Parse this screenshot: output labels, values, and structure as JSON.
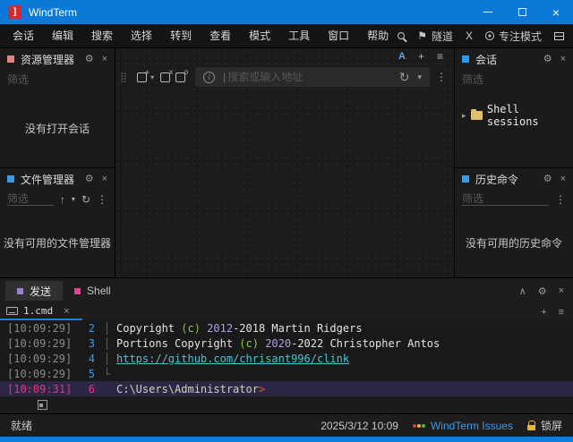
{
  "titlebar": {
    "app_title": "WindTerm"
  },
  "menubar": {
    "items": [
      "会话",
      "编辑",
      "搜索",
      "选择",
      "转到",
      "查看",
      "模式",
      "工具",
      "窗口",
      "帮助"
    ],
    "tunnel_label": "隧道",
    "x_server_label": "X",
    "focus_mode_label": "专注模式"
  },
  "glyphs": {
    "flag": "⚑",
    "gear": "⚙",
    "close": "×",
    "more": "⋮",
    "collapse": "∧",
    "plus": "+",
    "menu": "≡",
    "caret": "▾",
    "up": "↑",
    "refresh": "↻",
    "grip": "⣿",
    "tree_expand": "▸",
    "font_size": "A",
    "cursor": "|",
    "info": "i"
  },
  "panels": {
    "explorer": {
      "title": "资源管理器",
      "filter_placeholder": "筛选",
      "empty_text": "没有打开会话",
      "accent": "#e08585"
    },
    "file_manager": {
      "title": "文件管理器",
      "filter_placeholder": "筛选",
      "empty_text": "没有可用的文件管理器",
      "accent": "#3d9ae8"
    },
    "sessions": {
      "title": "会话",
      "filter_placeholder": "筛选",
      "tree_item_label": "Shell sessions",
      "accent": "#2b9af3"
    },
    "history": {
      "title": "历史命令",
      "filter_placeholder": "筛选",
      "empty_text": "没有可用的历史命令",
      "accent": "#3d9ae8"
    }
  },
  "address_bar": {
    "placeholder": "搜索或输入地址"
  },
  "bottom": {
    "tabs": [
      {
        "label": "发送",
        "color": "#9b7fd4",
        "active": true
      },
      {
        "label": "Shell",
        "color": "#e83e9c",
        "active": false
      }
    ],
    "doc_tab": {
      "label": "1.cmd"
    },
    "terminal": {
      "lines": [
        {
          "ts": "[10:09:29]",
          "num": "2",
          "guide": "│",
          "active": false,
          "segments": [
            {
              "text": "Copyright ",
              "cls": "c-white"
            },
            {
              "text": "(c) ",
              "cls": "c-green"
            },
            {
              "text": "2012",
              "cls": "c-purple"
            },
            {
              "text": "-2018 Martin Ridgers",
              "cls": "c-white"
            }
          ]
        },
        {
          "ts": "[10:09:29]",
          "num": "3",
          "guide": "│",
          "active": false,
          "segments": [
            {
              "text": "Portions Copyright ",
              "cls": "c-white"
            },
            {
              "text": "(c) ",
              "cls": "c-green"
            },
            {
              "text": "2020",
              "cls": "c-purple"
            },
            {
              "text": "-2022 Christopher Antos",
              "cls": "c-white"
            }
          ]
        },
        {
          "ts": "[10:09:29]",
          "num": "4",
          "guide": "│",
          "active": false,
          "segments": [
            {
              "text": "https://github.com/chrisant996/clink",
              "cls": "c-link"
            }
          ]
        },
        {
          "ts": "[10:09:29]",
          "num": "5",
          "guide": "└",
          "active": false,
          "segments": []
        },
        {
          "ts": "[10:09:31]",
          "num": "6",
          "guide": "",
          "active": true,
          "segments": [
            {
              "text": "C:\\Users\\Administrator",
              "cls": "c-prompt"
            },
            {
              "text": ">",
              "cls": "c-red"
            }
          ]
        }
      ]
    }
  },
  "statusbar": {
    "ready": "就绪",
    "datetime": "2025/3/12 10:09",
    "issues_label": "WindTerm Issues",
    "lock_label": "锁屏"
  },
  "colors": {
    "titlebar_blue": "#0b79d7",
    "accent_blue": "#1f7fd6",
    "link_blue": "#3d9ae8",
    "active_line_bg": "#2c2745",
    "active_line_fg": "#e8337f",
    "lock_yellow": "#e8b830",
    "logo_red": "#cf2b2b"
  }
}
